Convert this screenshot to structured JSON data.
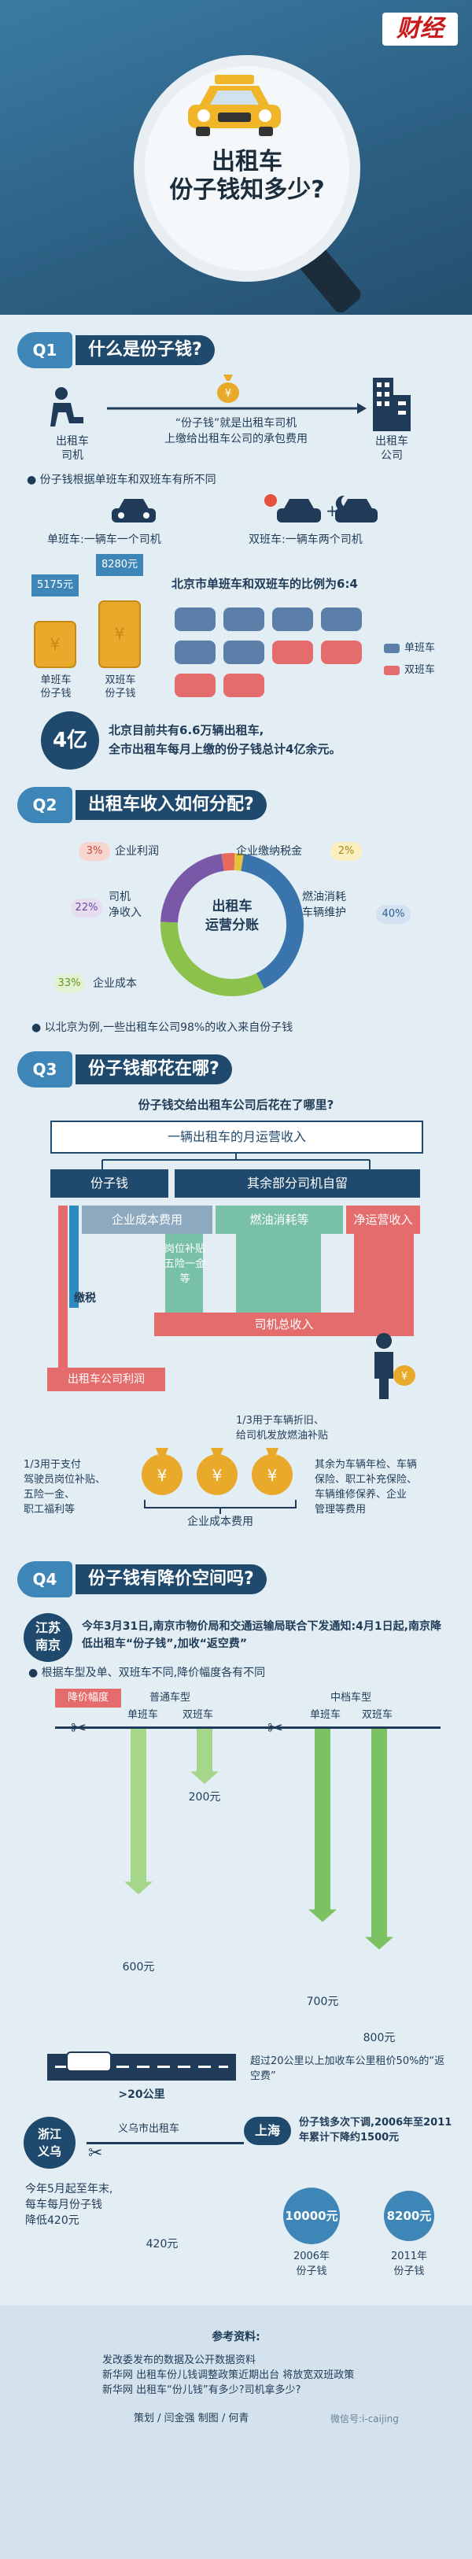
{
  "header": {
    "logo": "财经",
    "title_line1": "出租车",
    "title_line2": "份子钱知多少?"
  },
  "q1": {
    "badge": "Q1",
    "title": "什么是份子钱?",
    "driver_label": "出租车\n司机",
    "company_label": "出租车\n公司",
    "definition_line1": "“份子钱”就是出租车司机",
    "definition_line2": "上缴给出租车公司的承包费用",
    "bullet": "份子钱根据单班车和双班车有所不同",
    "single_shift_label": "单班车:一辆车一个司机",
    "double_shift_label": "双班车:一辆车两个司机",
    "single_amount": "5175元",
    "double_amount": "8280元",
    "single_fee_label": "单班车\n份子钱",
    "double_fee_label": "双班车\n份子钱",
    "ratio_text": "北京市单班车和双班车的比例为6:4",
    "legend_single": "单班车",
    "legend_double": "双班车",
    "big_number": "4亿",
    "total_line1": "北京目前共有6.6万辆出租车,",
    "total_line2": "全市出租车每月上缴的份子钱总计4亿余元。"
  },
  "q2": {
    "badge": "Q2",
    "title": "出租车收入如何分配?",
    "center_label": "出租车\n运营分账",
    "segments": [
      {
        "name": "企业利润",
        "percent": "3%",
        "value": 3,
        "color": "#e86a5a"
      },
      {
        "name": "企业缴纳税金",
        "percent": "2%",
        "value": 2,
        "color": "#e6c23a"
      },
      {
        "name": "燃油消耗\n车辆维护",
        "percent": "40%",
        "value": 40,
        "color": "#3a74ad"
      },
      {
        "name": "企业成本",
        "percent": "33%",
        "value": 33,
        "color": "#8cc24b"
      },
      {
        "name": "司机\n净收入",
        "percent": "22%",
        "value": 22,
        "color": "#7a58a8"
      }
    ],
    "note": "以北京为例,一些出租车公司98%的收入来自份子钱"
  },
  "q3": {
    "badge": "Q3",
    "title": "份子钱都花在哪?",
    "subtitle": "份子钱交给出租车公司后花在了哪里?",
    "top_box": "一辆出租车的月运营收入",
    "left_box": "份子钱",
    "right_box": "其余部分司机自留",
    "row_cost": "企业成本费用",
    "row_fuel": "燃油消耗等",
    "row_net": "净运营收入",
    "post_subsidy": "岗位补贴\n五险一金\n等",
    "tax": "缴税",
    "profit": "出租车公司利润",
    "driver_income": "司机总收入",
    "split_top": "1/3用于车辆折旧、\n给司机发放燃油补贴",
    "split_left": "1/3用于支付\n驾驶员岗位补贴、\n五险一金、\n职工福利等",
    "split_right": "其余为车辆年检、车辆\n保险、职工补充保险、\n车辆维修保养、企业\n管理等费用",
    "cost_footer": "企业成本费用"
  },
  "q4": {
    "badge": "Q4",
    "title": "份子钱有降价空间吗?",
    "nanjing_tag": "江苏\n南京",
    "nanjing_text": "今年3月31日,南京市物价局和交通运输局联合下发通知:4月1日起,南京降低出租车“份子钱”,加收“返空费”",
    "bullet": "根据车型及单、双班车不同,降价幅度各有不同",
    "range_label": "降价幅度",
    "ordinary": "普通车型",
    "midhigh": "中档车型",
    "single": "单班车",
    "double": "双班车",
    "single2": "单班车",
    "double2": "双班车",
    "values": [
      {
        "label": "600元",
        "amount": 600
      },
      {
        "label": "200元",
        "amount": 200
      },
      {
        "label": "700元",
        "amount": 700
      },
      {
        "label": "800元",
        "amount": 800
      }
    ],
    "road_label": ">20公里",
    "return_fee": "超过20公里以上加收车公里租价50%的“返空费”",
    "yiwu_tag": "浙江\n义乌",
    "yiwu_taxi": "义乌市出租车",
    "yiwu_text": "今年5月起至年末,\n每车每月份子钱\n降低420元",
    "yiwu_amount": "420元",
    "shanghai_tag": "上海",
    "shanghai_text": "份子钱多次下调,2006年至2011年累计下降约1500元",
    "sh_2006": "10000元",
    "sh_2011": "8200元",
    "sh_2006_label": "2006年\n份子钱",
    "sh_2011_label": "2011年\n份子钱"
  },
  "footer": {
    "ref_title": "参考资料:",
    "ref1": "发改委发布的数据及公开数据资料",
    "ref2": "新华网 出租车份儿钱调整政策近期出台 将放宽双班政策",
    "ref3": "新华网 出租车“份儿钱”有多少?司机拿多少?",
    "credits": "策划 / 闫金强  制图 / 何青",
    "watermark": "微信号:i-caijing"
  },
  "colors": {
    "accent": "#3f86b8",
    "dark": "#1f4a6d",
    "red": "#e46c6c",
    "green": "#7dc26b"
  }
}
